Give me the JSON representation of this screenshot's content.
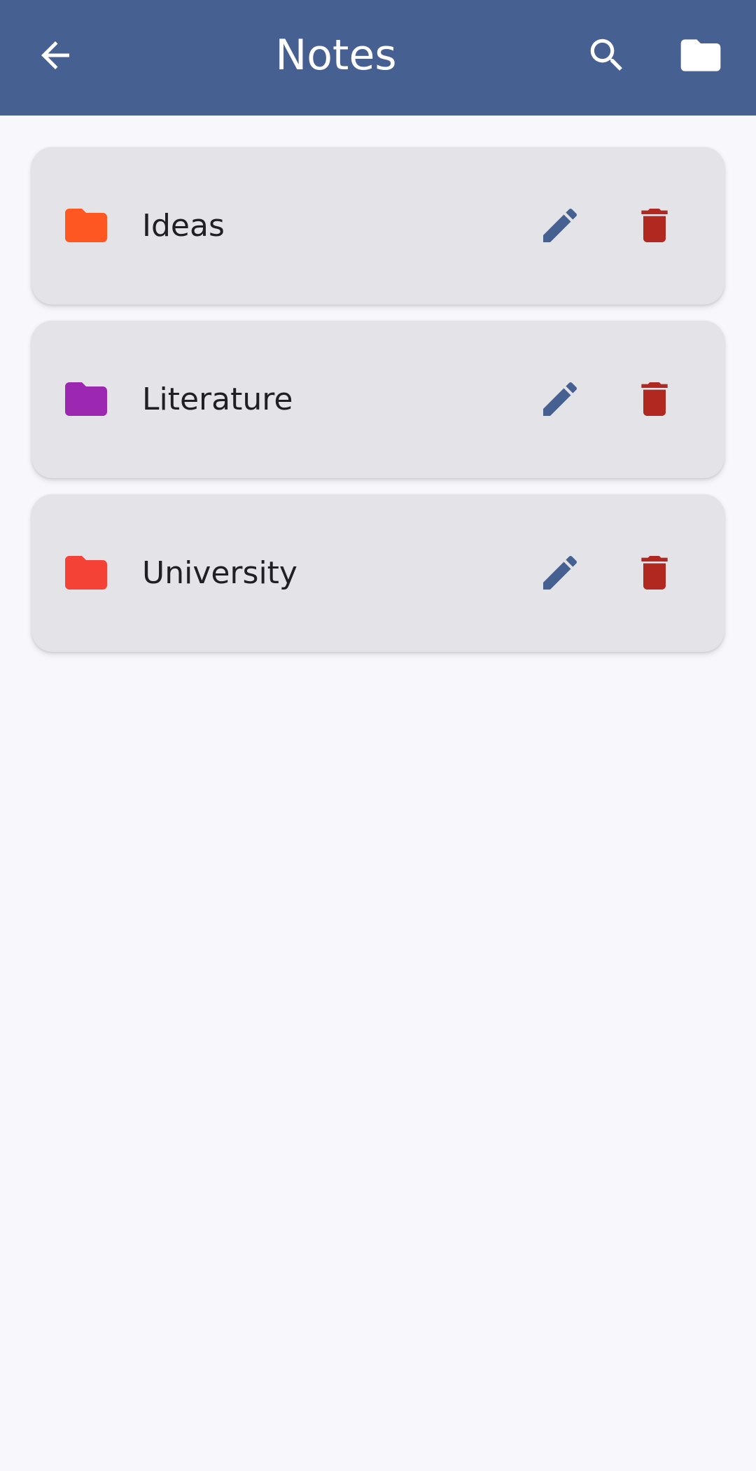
{
  "app_bar": {
    "title": "Notes",
    "background_color": "#466092",
    "icons": {
      "back": "arrow-back-icon",
      "search": "search-icon",
      "folder": "folder-icon"
    }
  },
  "folders": [
    {
      "name": "Ideas",
      "color": "#ff5722"
    },
    {
      "name": "Literature",
      "color": "#9c27b0"
    },
    {
      "name": "University",
      "color": "#f44336"
    }
  ],
  "action_colors": {
    "edit": "#466092",
    "delete": "#b02820"
  }
}
